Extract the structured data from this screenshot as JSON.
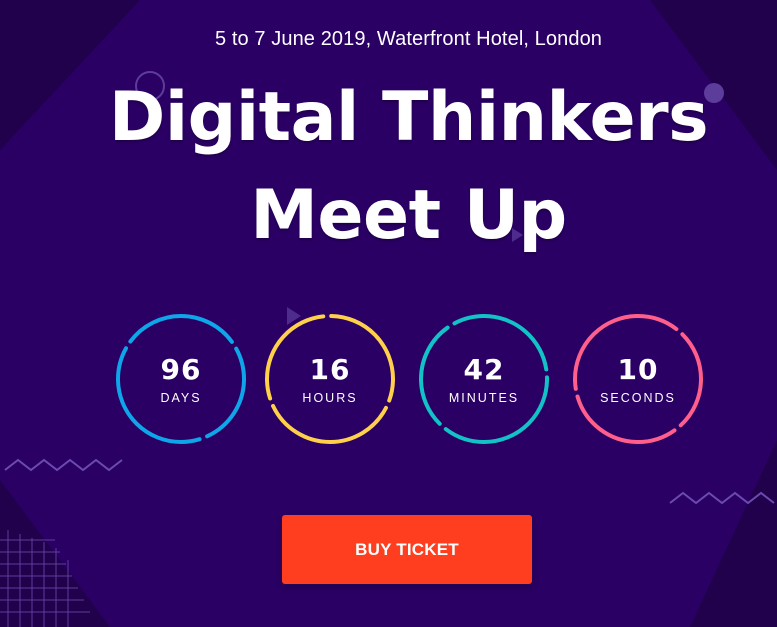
{
  "event": {
    "subtitle": "5 to 7 June 2019, Waterfront Hotel, London",
    "title_line1": "Digital Thinkers",
    "title_line2": "Meet Up"
  },
  "countdown": [
    {
      "value": "96",
      "label": "DAYS",
      "color": "#0ea5e9"
    },
    {
      "value": "16",
      "label": "HOURS",
      "color": "#ffd04a"
    },
    {
      "value": "42",
      "label": "MINUTES",
      "color": "#12c2c6"
    },
    {
      "value": "10",
      "label": "SECONDS",
      "color": "#ff5f8a"
    }
  ],
  "cta": {
    "label": "BUY TICKET",
    "color": "#fe3e1f"
  },
  "theme": {
    "background": "#2a0064",
    "text": "#ffffff"
  },
  "decorations": [
    "circle-outline-icon",
    "dot-icon",
    "play-triangle-icon",
    "zigzag-line-icon",
    "grid-pattern-icon"
  ]
}
